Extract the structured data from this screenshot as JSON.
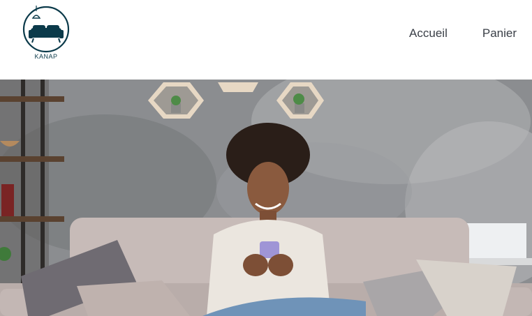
{
  "brand": {
    "name": "KANAP",
    "logo_icon": "sofa-lamp-logo-icon"
  },
  "nav": {
    "items": [
      {
        "label": "Accueil"
      },
      {
        "label": "Panier"
      }
    ]
  },
  "colors": {
    "logo": "#0b3a4a",
    "nav_text": "#3a3f47"
  }
}
